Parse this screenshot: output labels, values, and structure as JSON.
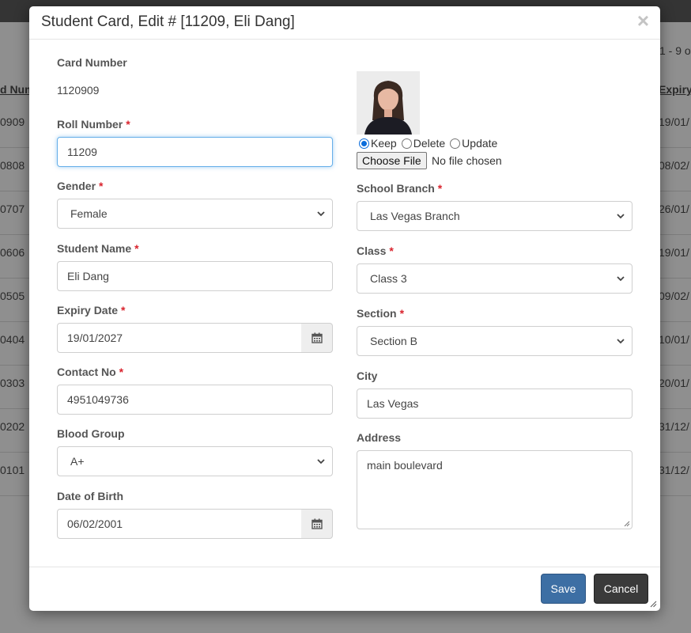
{
  "background": {
    "pager_text": "1 - 9 o",
    "left_header": "d Num",
    "right_header": "Expiry",
    "left_cells": [
      "0909",
      "0808",
      "0707",
      "0606",
      "0505",
      "0404",
      "0303",
      "0202",
      "0101"
    ],
    "right_cells": [
      "19/01/",
      "08/02/",
      "26/01/",
      "19/01/",
      "09/02/",
      "10/01/",
      "20/01/",
      "31/12/",
      "31/12/"
    ]
  },
  "modal": {
    "title": "Student Card, Edit # [11209, Eli Dang]"
  },
  "form": {
    "card_number": {
      "label": "Card Number",
      "value": "1120909"
    },
    "roll_number": {
      "label": "Roll Number",
      "value": "11209"
    },
    "gender": {
      "label": "Gender",
      "value": "Female"
    },
    "student_name": {
      "label": "Student Name",
      "value": "Eli Dang"
    },
    "expiry_date": {
      "label": "Expiry Date",
      "value": "19/01/2027"
    },
    "contact_no": {
      "label": "Contact No",
      "value": "4951049736"
    },
    "blood_group": {
      "label": "Blood Group",
      "value": "A+"
    },
    "date_of_birth": {
      "label": "Date of Birth",
      "value": "06/02/2001"
    },
    "photo_options": {
      "keep": "Keep",
      "delete": "Delete",
      "update": "Update"
    },
    "file_button": "Choose File",
    "file_status": "No file chosen",
    "school_branch": {
      "label": "School Branch",
      "value": "Las Vegas Branch"
    },
    "class": {
      "label": "Class",
      "value": "Class 3"
    },
    "section": {
      "label": "Section",
      "value": "Section B"
    },
    "city": {
      "label": "City",
      "value": "Las Vegas"
    },
    "address": {
      "label": "Address",
      "value": "main boulevard"
    },
    "required_marker": "*"
  },
  "footer": {
    "save_label": "Save",
    "cancel_label": "Cancel"
  },
  "icons": {
    "close": "close-icon",
    "calendar": "calendar-icon",
    "dropdown": "chevron-down-icon"
  },
  "colors": {
    "primary_button": "#3d6fa4",
    "cancel_button": "#3a3a3a",
    "required": "#d9232d",
    "focus": "#66afe9"
  }
}
